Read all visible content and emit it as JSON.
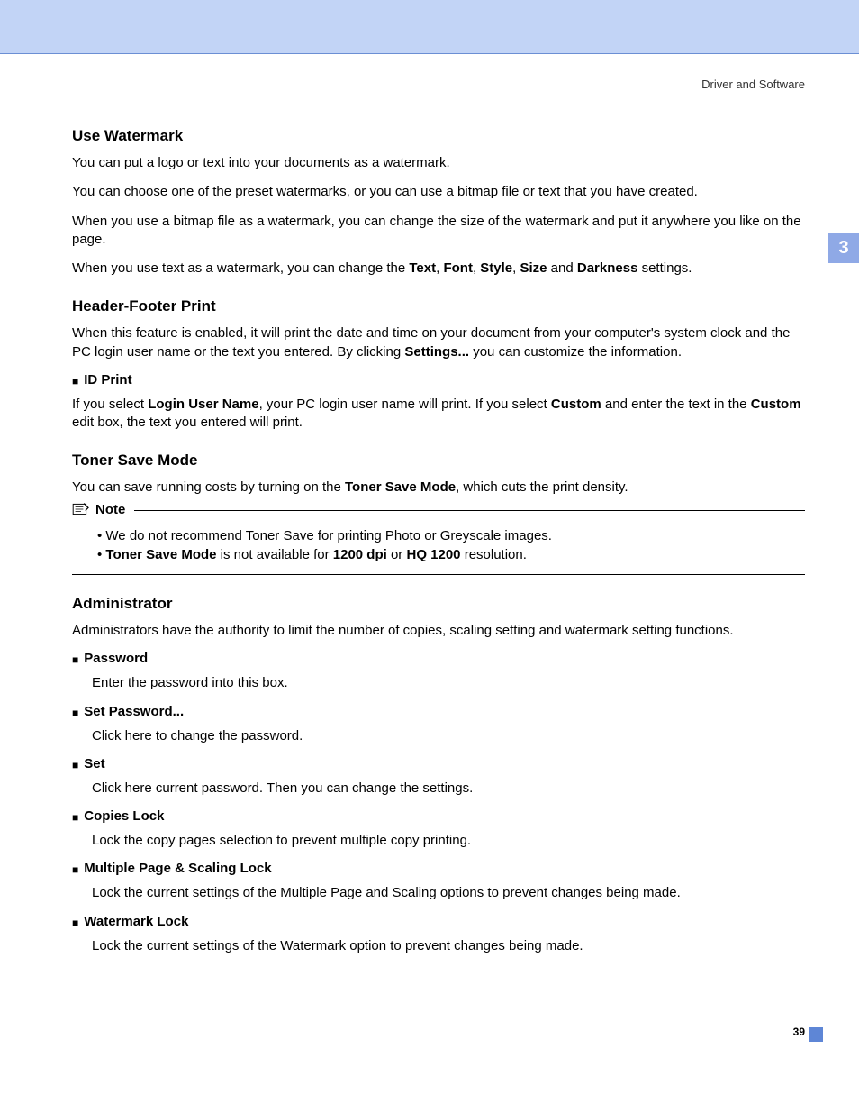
{
  "breadcrumb": "Driver and Software",
  "chapter_tab": "3",
  "page_number": "39",
  "sections": {
    "watermark": {
      "title": "Use Watermark",
      "p1": "You can put a logo or text into your documents as a watermark.",
      "p2": "You can choose one of the preset watermarks, or you can use a bitmap file or text that you have created.",
      "p3": "When you use a bitmap file as a watermark, you can change the size of the watermark and put it anywhere you like on the page.",
      "p4_pre": "When you use text as a watermark, you can change the ",
      "p4_b1": "Text",
      "p4_c1": ", ",
      "p4_b2": "Font",
      "p4_c2": ", ",
      "p4_b3": "Style",
      "p4_c3": ", ",
      "p4_b4": "Size",
      "p4_c4": " and ",
      "p4_b5": "Darkness",
      "p4_post": " settings."
    },
    "header_footer": {
      "title": "Header-Footer Print",
      "p1_pre": "When this feature is enabled, it will print the date and time on your document from your computer's system clock and the PC login user name or the text you entered. By clicking ",
      "p1_b1": "Settings...",
      "p1_post": " you can customize the information.",
      "idprint_label": "ID Print",
      "p2_pre": "If you select ",
      "p2_b1": "Login User Name",
      "p2_mid1": ", your PC login user name will print. If you select ",
      "p2_b2": "Custom",
      "p2_mid2": " and enter the text in the ",
      "p2_b3": "Custom",
      "p2_post": " edit box, the text you entered will print."
    },
    "toner": {
      "title": "Toner Save Mode",
      "p1_pre": "You can save running costs by turning on the ",
      "p1_b1": "Toner Save Mode",
      "p1_post": ", which cuts the print density.",
      "note_title": "Note",
      "note1": "We do not recommend Toner Save for printing Photo or Greyscale images.",
      "note2_b1": "Toner Save Mode",
      "note2_m1": " is not available for ",
      "note2_b2": "1200 dpi",
      "note2_m2": " or ",
      "note2_b3": "HQ 1200",
      "note2_post": " resolution."
    },
    "admin": {
      "title": "Administrator",
      "p1": "Administrators have the authority to limit the number of copies, scaling setting and watermark setting functions.",
      "items": {
        "password": {
          "label": "Password",
          "desc": "Enter the password into this box."
        },
        "set_password": {
          "label": "Set Password...",
          "desc": "Click here to change the password."
        },
        "set": {
          "label": "Set",
          "desc": "Click here current password. Then you can change the settings."
        },
        "copies_lock": {
          "label": "Copies Lock",
          "desc": "Lock the copy pages selection to prevent multiple copy printing."
        },
        "mps_lock": {
          "label": "Multiple Page & Scaling Lock",
          "desc": "Lock the current settings of the Multiple Page and Scaling options to prevent changes being made."
        },
        "wm_lock": {
          "label": "Watermark Lock",
          "desc": "Lock the current settings of the Watermark option to prevent changes being made."
        }
      }
    }
  }
}
